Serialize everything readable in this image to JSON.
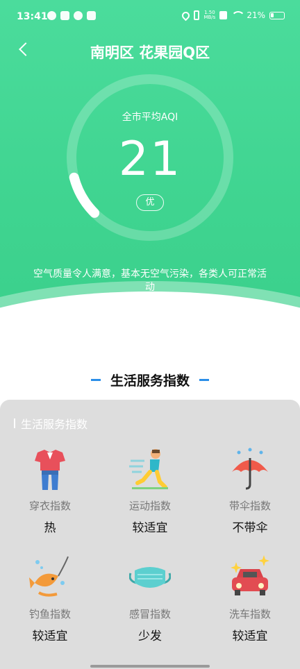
{
  "status_bar": {
    "time": "13:41",
    "net_speed_top": "1.50",
    "net_speed_bottom": "MB/s",
    "battery": "21%"
  },
  "header": {
    "title": "南明区 花果园Q区"
  },
  "aqi": {
    "label": "全市平均AQI",
    "value": "21",
    "level": "优",
    "description": "空气质量令人满意，基本无空气污染，各类人可正常活动",
    "fraction": 0.042
  },
  "section": {
    "heading": "生活服务指数"
  },
  "card": {
    "title": "生活服务指数",
    "items": [
      {
        "name": "穿衣指数",
        "value": "热",
        "icon": "clothes-icon"
      },
      {
        "name": "运动指数",
        "value": "较适宜",
        "icon": "running-icon"
      },
      {
        "name": "带伞指数",
        "value": "不带伞",
        "icon": "umbrella-icon"
      },
      {
        "name": "钓鱼指数",
        "value": "较适宜",
        "icon": "fishing-icon"
      },
      {
        "name": "感冒指数",
        "value": "少发",
        "icon": "mask-icon"
      },
      {
        "name": "洗车指数",
        "value": "较适宜",
        "icon": "car-wash-icon"
      }
    ]
  },
  "colors": {
    "accent_green": "#3fd490",
    "heading_bar": "#2b8ee8",
    "card_bg": "#dddddd"
  }
}
